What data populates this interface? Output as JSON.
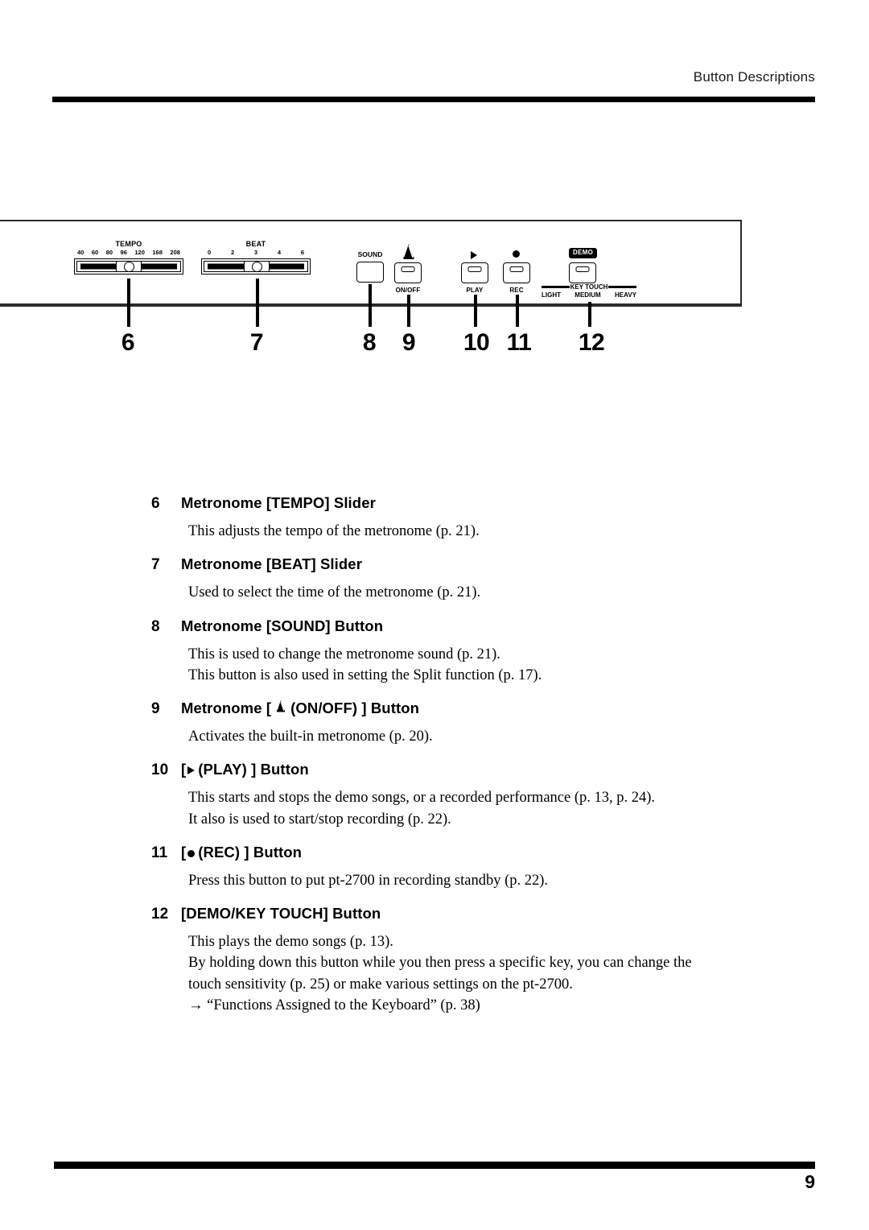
{
  "header": {
    "title": "Button Descriptions"
  },
  "footer": {
    "page_number": "9"
  },
  "panel_diagram": {
    "tempo_slider": {
      "title": "TEMPO",
      "scale": [
        "40",
        "60",
        "80",
        "96",
        "120",
        "168",
        "208"
      ],
      "callout": "6"
    },
    "beat_slider": {
      "title": "BEAT",
      "scale": [
        "0",
        "2",
        "3",
        "4",
        "6"
      ],
      "callout": "7"
    },
    "sound_button": {
      "label": "SOUND",
      "callout": "8"
    },
    "onoff_button": {
      "label": "ON/OFF",
      "icon": "metronome-icon",
      "callout": "9"
    },
    "play_button": {
      "label": "PLAY",
      "icon": "play-triangle-icon",
      "callout": "10"
    },
    "rec_button": {
      "label": "REC",
      "icon": "record-dot-icon",
      "callout": "11"
    },
    "demo_key_touch_button": {
      "chip_label": "DEMO",
      "scale_title": "KEY TOUCH",
      "options": [
        "LIGHT",
        "MEDIUM",
        "HEAVY"
      ],
      "callout": "12"
    }
  },
  "entries": [
    {
      "num": "6",
      "title": "Metronome [TEMPO] Slider",
      "lines": [
        "This adjusts the tempo of the metronome (p. 21)."
      ]
    },
    {
      "num": "7",
      "title": "Metronome [BEAT] Slider",
      "lines": [
        "Used to select the time of the metronome (p. 21)."
      ]
    },
    {
      "num": "8",
      "title": "Metronome [SOUND] Button",
      "lines": [
        "This is used to change the metronome sound (p. 21).",
        "This button is also used in setting the Split function (p. 17)."
      ]
    },
    {
      "num": "9",
      "title_prefix": "Metronome [",
      "title_suffix": "(ON/OFF) ] Button",
      "lines": [
        "Activates the built-in metronome (p. 20)."
      ]
    },
    {
      "num": "10",
      "title_prefix": "[",
      "title_suffix": "(PLAY) ] Button",
      "lines": [
        "This starts and stops the demo songs, or a recorded performance (p. 13, p. 24).",
        "It also is used to start/stop recording (p. 22)."
      ]
    },
    {
      "num": "11",
      "title_prefix": "[",
      "title_suffix": "(REC) ] Button",
      "lines": [
        "Press this button to put pt-2700 in recording standby (p. 22)."
      ]
    },
    {
      "num": "12",
      "title": "[DEMO/KEY TOUCH] Button",
      "lines": [
        "This plays the demo songs (p. 13).",
        "By holding down this button while you then press a specific key, you can change the",
        "touch sensitivity (p. 25) or make various settings on the pt-2700.",
        "→ “Functions Assigned to the Keyboard” (p. 38)"
      ]
    }
  ]
}
